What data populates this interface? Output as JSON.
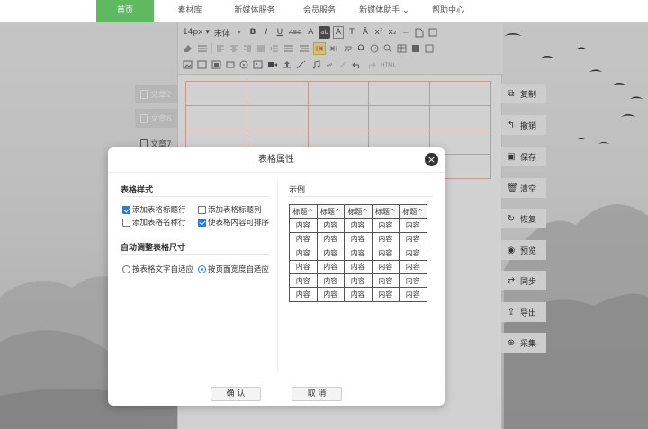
{
  "nav": {
    "items": [
      {
        "label": "首页",
        "active": true
      },
      {
        "label": "素材库",
        "active": false
      },
      {
        "label": "新媒体服务",
        "active": false
      },
      {
        "label": "会员服务",
        "active": false
      },
      {
        "label": "新媒体助手 ⌄",
        "active": false
      },
      {
        "label": "帮助中心",
        "active": false
      }
    ]
  },
  "toolbar": {
    "font_size": "14px ▾",
    "font_family": "宋体",
    "font_family_arrow": "▾",
    "bold": "B",
    "italic": "I",
    "underline": "U",
    "strike": "ABC",
    "font_color": "A",
    "bg_color": "ab",
    "clear": "A",
    "paint": "T",
    "case": "Ā",
    "superscript": "x²",
    "subscript": "x₂",
    "dash": "—",
    "html_label": "HTML",
    "omega": "Ω"
  },
  "articles": [
    {
      "label": "文章2"
    },
    {
      "label": "文章6"
    },
    {
      "label": "文章7"
    }
  ],
  "actions": [
    {
      "label": "复制",
      "icon": "⧉"
    },
    {
      "label": "撤销",
      "icon": "↰"
    },
    {
      "label": "保存",
      "icon": "▣"
    },
    {
      "label": "清空",
      "icon": "🗑"
    },
    {
      "label": "恢复",
      "icon": "↻"
    },
    {
      "label": "预览",
      "icon": "◉"
    },
    {
      "label": "同步",
      "icon": "⇄"
    },
    {
      "label": "导出",
      "icon": "⇪"
    },
    {
      "label": "采集",
      "icon": "⊕"
    }
  ],
  "dialog": {
    "title": "表格属性",
    "close": "×",
    "section_style": "表格样式",
    "opt_title_row": "添加表格标题行",
    "opt_title_col": "添加表格标题列",
    "opt_caption": "添加表格名称行",
    "opt_sortable": "使表格内容可排序",
    "section_size": "自动调整表格尺寸",
    "opt_fit_text": "按表格文字自适应",
    "opt_fit_page": "按页面宽度自适应",
    "section_sample": "示例",
    "sample_header": [
      "标题^",
      "标题^",
      "标题^",
      "标题^",
      "标题^"
    ],
    "sample_cell": "内容",
    "ok": "确 认",
    "cancel": "取 消"
  }
}
